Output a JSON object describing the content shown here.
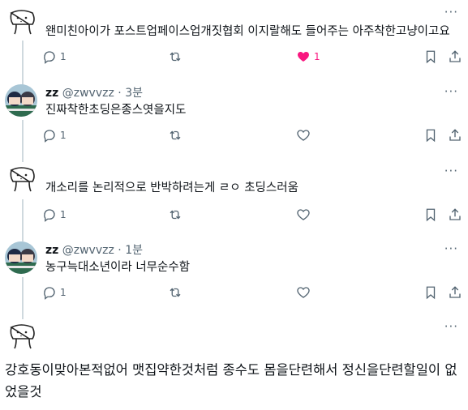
{
  "posts": [
    {
      "avatar": "dog-sketch",
      "text": "왠미친아이가 포스트업페이스업개짓협회 이지랄해도 들어주는 아주착한고냥이고요",
      "reply_count": "1",
      "like_count": "1",
      "liked": true
    },
    {
      "avatar": "anime-photo",
      "name": "zz",
      "handle": "@zwvvzz",
      "separator": "·",
      "time": "3분",
      "text": "진짜착한초딩은종스엿을지도",
      "reply_count": "1"
    },
    {
      "avatar": "dog-sketch",
      "text": "개소리를 논리적으로 반박하려는게 ㄹㅇ 초딩스러움",
      "reply_count": "1"
    },
    {
      "avatar": "anime-photo",
      "name": "zz",
      "handle": "@zwvvzz",
      "separator": "·",
      "time": "1분",
      "text": "농구늑대소년이라 너무순수함",
      "reply_count": "1"
    },
    {
      "avatar": "dog-sketch",
      "text": "강호동이맞아본적없어 맷집약한것처럼 종수도 몸을단련해서 정신을단련할일이 없었을것"
    }
  ],
  "more_label": "···",
  "colors": {
    "like": "#f91880",
    "muted": "#536471",
    "line": "#cfd9de"
  }
}
